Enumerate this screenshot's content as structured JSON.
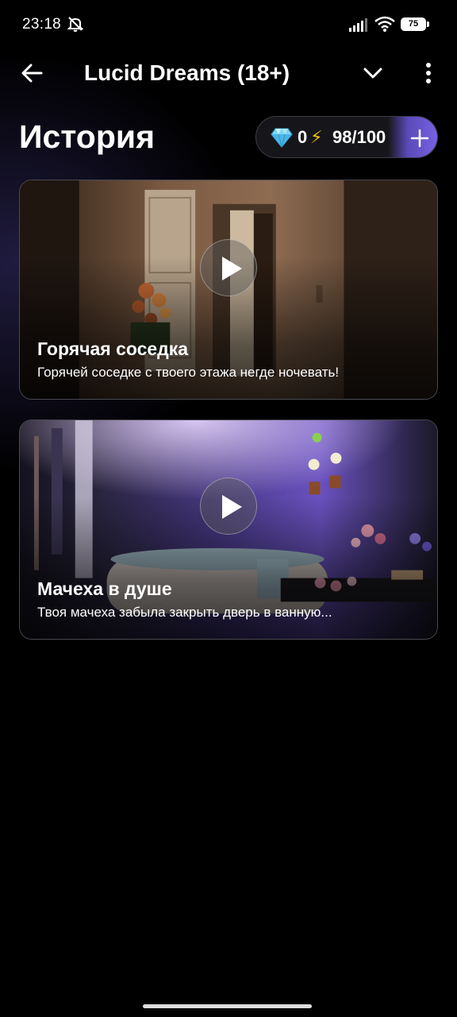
{
  "status_bar": {
    "time": "23:18",
    "battery": "75",
    "icons": [
      "mute-icon",
      "signal-icon",
      "wifi-icon",
      "battery-icon"
    ]
  },
  "app_bar": {
    "title": "Lucid Dreams (18+)",
    "icons": [
      "back-arrow-icon",
      "chevron-down-icon",
      "more-vertical-icon"
    ]
  },
  "section": {
    "title": "История"
  },
  "balance": {
    "gems": "0",
    "energy": "98/100",
    "icons": [
      "gem-icon",
      "lightning-icon",
      "plus-icon"
    ]
  },
  "stories": [
    {
      "title": "Горячая соседка",
      "description": "Горячей соседке с твоего этажа негде ночевать!"
    },
    {
      "title": "Мачеха в душе",
      "description": "Твоя мачеха забыла закрыть дверь в ванную..."
    }
  ],
  "colors": {
    "background": "#000000",
    "accent": "#7761e3",
    "energy": "#ffc400",
    "card_border": "#4a4a52"
  }
}
